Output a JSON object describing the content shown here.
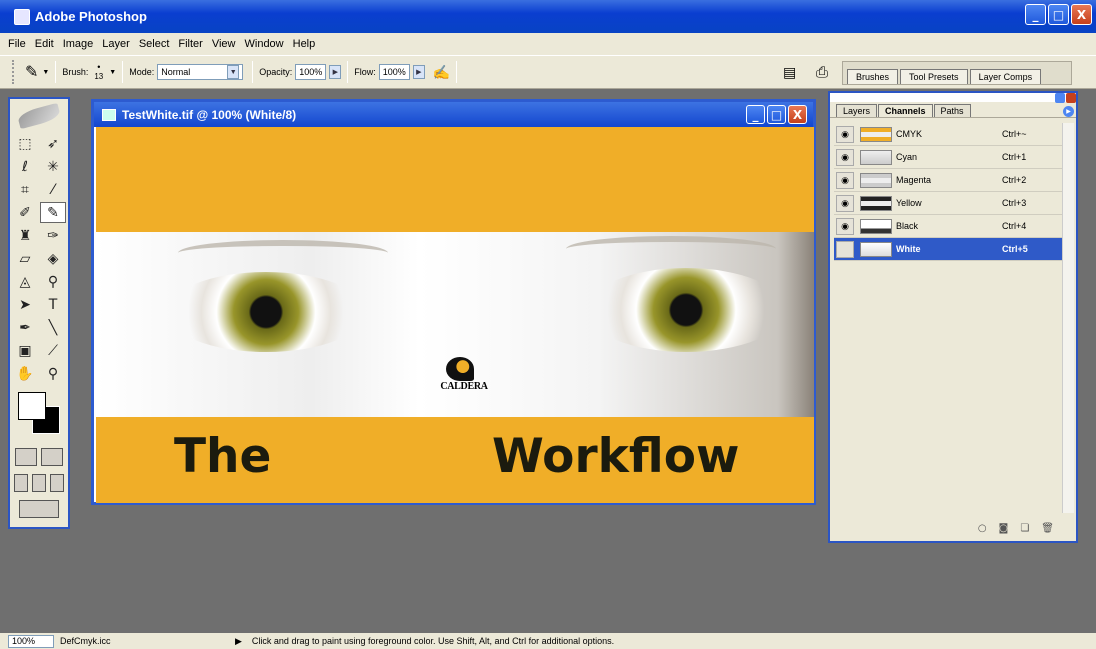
{
  "app": {
    "title": "Adobe Photoshop"
  },
  "window_buttons": {
    "minimize": "_",
    "maximize": "□",
    "close": "X"
  },
  "menu": [
    "File",
    "Edit",
    "Image",
    "Layer",
    "Select",
    "Filter",
    "View",
    "Window",
    "Help"
  ],
  "options": {
    "brush_label": "Brush:",
    "brush_size": "13",
    "mode_label": "Mode:",
    "mode_value": "Normal",
    "opacity_label": "Opacity:",
    "opacity_value": "100%",
    "flow_label": "Flow:",
    "flow_value": "100%"
  },
  "palette_well": [
    "Brushes",
    "Tool Presets",
    "Layer Comps"
  ],
  "document": {
    "title": "TestWhite.tif @ 100% (White/8)",
    "logo_text": "CALDERA",
    "text_left": "The",
    "text_right": "Workflow",
    "band_color": "#f0ae28"
  },
  "panel": {
    "tabs": [
      "Layers",
      "Channels",
      "Paths"
    ],
    "active_tab": "Channels",
    "channels": [
      {
        "name": "CMYK",
        "shortcut": "Ctrl+~",
        "visible": true
      },
      {
        "name": "Cyan",
        "shortcut": "Ctrl+1",
        "visible": true
      },
      {
        "name": "Magenta",
        "shortcut": "Ctrl+2",
        "visible": true
      },
      {
        "name": "Yellow",
        "shortcut": "Ctrl+3",
        "visible": true
      },
      {
        "name": "Black",
        "shortcut": "Ctrl+4",
        "visible": true
      },
      {
        "name": "White",
        "shortcut": "Ctrl+5",
        "visible": false
      }
    ]
  },
  "status": {
    "zoom": "100%",
    "profile": "DefCmyk.icc",
    "message": "Click and drag to paint using foreground color.  Use Shift, Alt, and Ctrl for additional options."
  }
}
